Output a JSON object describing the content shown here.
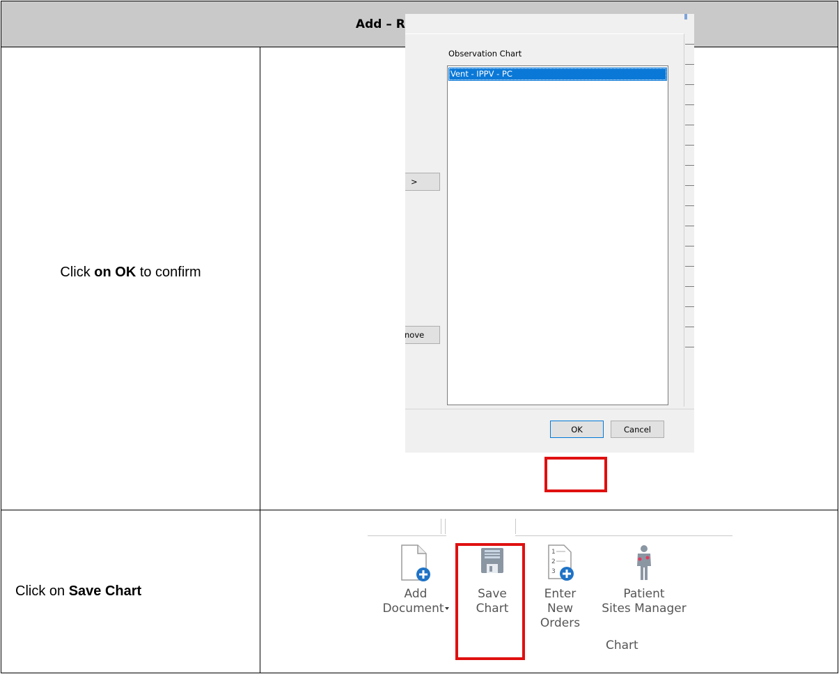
{
  "header": {
    "title": "Add – Row Families"
  },
  "steps": [
    {
      "prefix": "Click ",
      "bold": "on OK",
      "suffix": " to confirm"
    },
    {
      "prefix": "Click on ",
      "bold": "Save Chart",
      "suffix": ""
    }
  ],
  "dialog": {
    "list_label": "Observation Chart",
    "selected_item": "Vent - IPPV - PC",
    "add_button": ">",
    "remove_button": "nove",
    "ok_button": "OK",
    "cancel_button": "Cancel"
  },
  "ribbon": {
    "add_document": [
      "Add",
      "Document"
    ],
    "save_chart": [
      "Save",
      "Chart"
    ],
    "enter_new_orders": [
      "Enter",
      "New Orders"
    ],
    "patient_sites_manager": [
      "Patient",
      "Sites Manager"
    ],
    "group_label": "Chart"
  },
  "colors": {
    "header_bg": "#c9c9c9",
    "highlight": "#e01010",
    "selection": "#0a78d7",
    "ribbon_blue": "#1f73c6"
  }
}
